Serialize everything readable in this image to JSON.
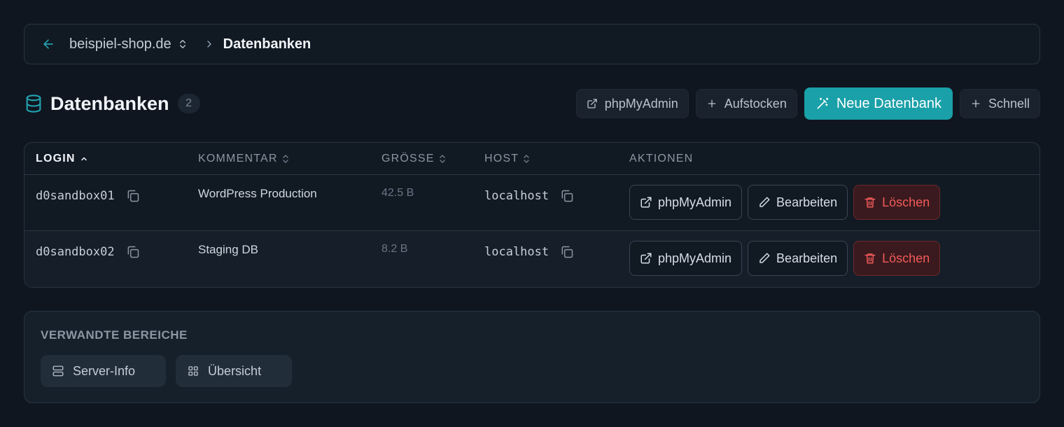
{
  "breadcrumb": {
    "site": "beispiel-shop.de",
    "current": "Datenbanken"
  },
  "header": {
    "title": "Datenbanken",
    "count": "2",
    "actions": {
      "phpmyadmin": "phpMyAdmin",
      "aufstocken": "Aufstocken",
      "neue_datenbank": "Neue Datenbank",
      "schnell": "Schnell"
    }
  },
  "table": {
    "columns": {
      "login": "LOGIN",
      "kommentar": "KOMMENTAR",
      "groesse": "GRÖSSE",
      "host": "HOST",
      "aktionen": "AKTIONEN"
    },
    "rows": [
      {
        "login": "d0sandbox01",
        "comment": "WordPress Production",
        "size": "42.5 B",
        "host": "localhost"
      },
      {
        "login": "d0sandbox02",
        "comment": "Staging DB",
        "size": "8.2 B",
        "host": "localhost"
      }
    ],
    "row_actions": {
      "phpmyadmin": "phpMyAdmin",
      "edit": "Bearbeiten",
      "delete": "Löschen"
    }
  },
  "related": {
    "title": "VERWANDTE BEREICHE",
    "links": [
      {
        "label": "Server-Info",
        "icon": "server-icon"
      },
      {
        "label": "Übersicht",
        "icon": "grid-icon"
      }
    ]
  },
  "colors": {
    "accent": "#1aa0a8",
    "danger": "#f25a5a",
    "background": "#0f1620"
  }
}
